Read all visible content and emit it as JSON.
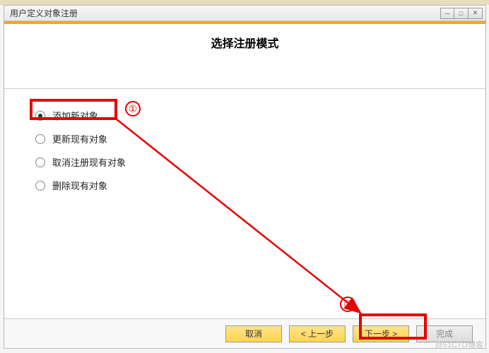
{
  "window": {
    "title": "用户定义对象注册"
  },
  "header": {
    "title": "选择注册模式"
  },
  "radios": [
    {
      "label": "添加新对象",
      "checked": true
    },
    {
      "label": "更新现有对象",
      "checked": false
    },
    {
      "label": "取消注册现有对象",
      "checked": false
    },
    {
      "label": "删除现有对象",
      "checked": false
    }
  ],
  "buttons": {
    "cancel": "取消",
    "prev": "< 上一步",
    "next": "下一步 >",
    "finish": "完成"
  },
  "annotations": {
    "num1": "①",
    "num2": "②"
  },
  "watermark": "@51CTO博客"
}
